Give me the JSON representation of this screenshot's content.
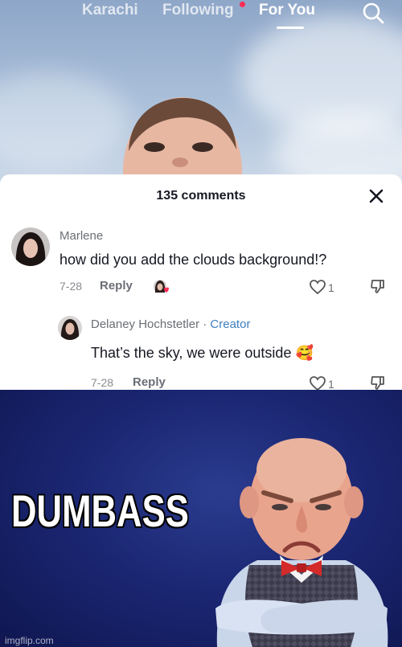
{
  "nav": {
    "tabs": [
      "Karachi",
      "Following",
      "For You"
    ],
    "active_tab": "For You",
    "has_notification_dot": true
  },
  "comments_sheet": {
    "title": "135 comments",
    "comments": [
      {
        "name": "Marlene",
        "text": "how did you add the clouds background!?",
        "date": "7-28",
        "reply_label": "Reply",
        "like_count": "1"
      }
    ],
    "reply": {
      "name": "Delaney Hochstetler",
      "separator": " · ",
      "badge": "Creator",
      "text": "That’s the sky, we were outside",
      "emoji": "🥰",
      "date": "7-28",
      "reply_label": "Reply",
      "like_count": "1"
    }
  },
  "meme": {
    "caption": "DUMBASS",
    "watermark": "imgflip.com"
  },
  "colors": {
    "accent_red": "#fe2c55",
    "creator_blue": "#3f7fbf",
    "meme_background": "#1b2773"
  }
}
